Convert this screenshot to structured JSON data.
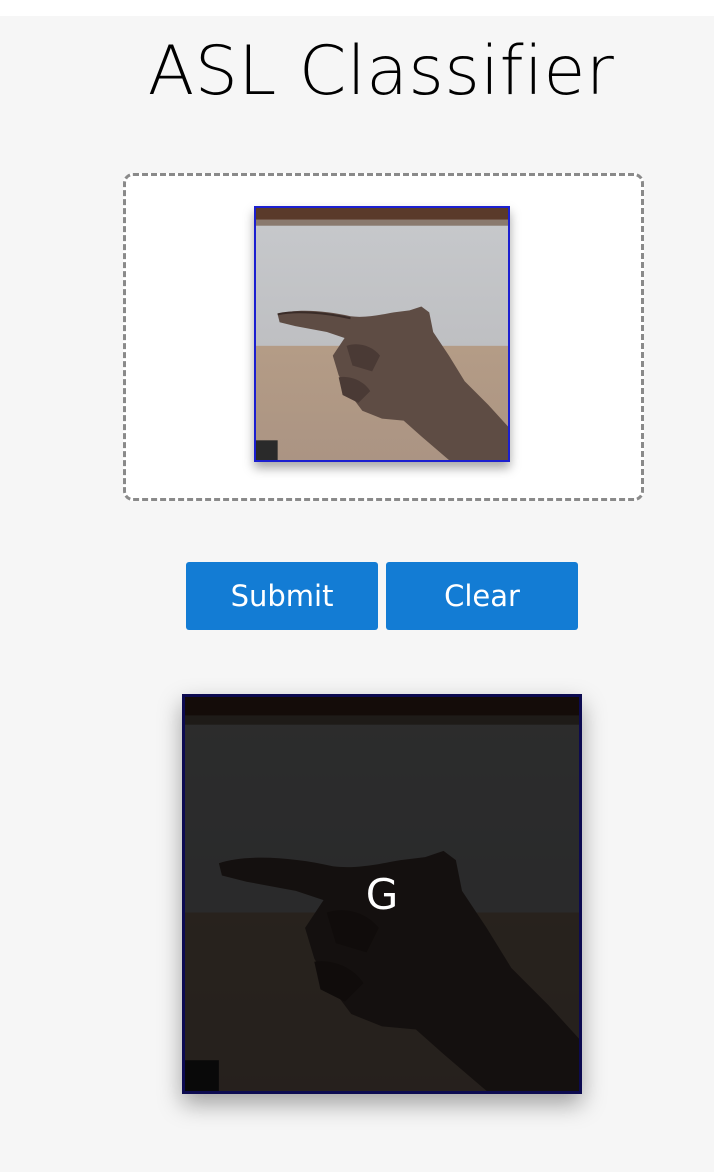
{
  "title": "ASL Classifier",
  "upload": {
    "image_description": "hand-sign-photo"
  },
  "buttons": {
    "submit_label": "Submit",
    "clear_label": "Clear"
  },
  "result": {
    "prediction": "G"
  },
  "colors": {
    "accent": "#137cd4",
    "background": "#f6f6f6",
    "small_image_border": "#1b1fd0",
    "large_image_border": "#0c0a50"
  }
}
